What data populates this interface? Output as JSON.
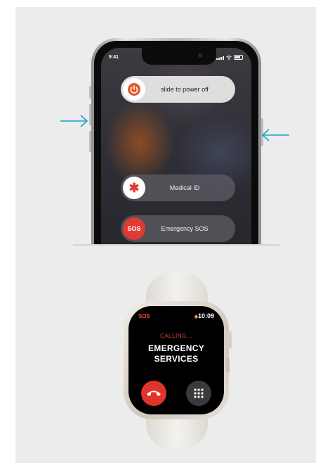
{
  "iphone": {
    "status_time": "9:41",
    "power_slider_label": "slide to power off",
    "medical_id_label": "Medical ID",
    "medical_id_icon_text": "✱",
    "sos_badge": "SOS",
    "emergency_sos_label": "Emergency SOS"
  },
  "watch": {
    "sos_label": "SOS",
    "time": "10:09",
    "status": "CALLING...",
    "title_line1": "EMERGENCY",
    "title_line2": "SERVICES"
  },
  "icons": [
    "power-icon",
    "medical-asterisk-icon",
    "arrow-right-icon",
    "arrow-left-icon",
    "end-call-icon",
    "keypad-icon"
  ],
  "colors": {
    "arrow": "#1a9fd0",
    "sos_red": "#e23a33",
    "calling_red": "#e0463e",
    "power_icon_bg": "#e35a2a",
    "background": "#ececec"
  }
}
